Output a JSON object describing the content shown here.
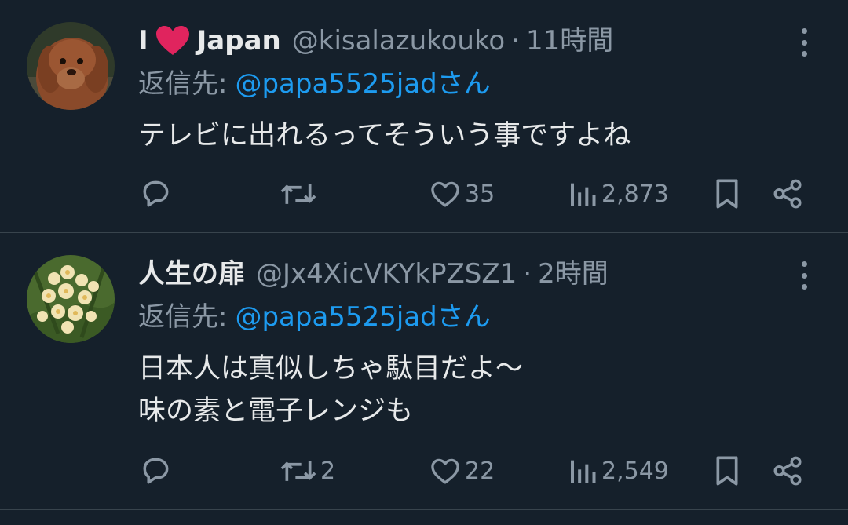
{
  "tweets": [
    {
      "name_prefix": "I",
      "name_suffix": "Japan",
      "handle": "@kisalazukouko",
      "separator": "·",
      "time": "11時間",
      "reply_label": "返信先:",
      "reply_mention": "@papa5525jadさん",
      "text_lines": [
        "テレビに出れるってそういう事ですよね"
      ],
      "reply_count": "",
      "retweet_count": "",
      "like_count": "35",
      "view_count": "2,873"
    },
    {
      "name": "人生の扉",
      "handle": "@Jx4XicVKYkPZSZ1",
      "separator": "·",
      "time": "2時間",
      "reply_label": "返信先:",
      "reply_mention": "@papa5525jadさん",
      "text_lines": [
        "日本人は真似しちゃ駄目だよ〜",
        "味の素と電子レンジも"
      ],
      "reply_count": "",
      "retweet_count": "2",
      "like_count": "22",
      "view_count": "2,549"
    }
  ],
  "colors": {
    "background": "#15202b",
    "divider": "#38444d",
    "text": "#e7e9ea",
    "muted": "#8b98a5",
    "link": "#1d9bf0",
    "heart_emoji": "#e0245e"
  },
  "icons": {
    "reply": "speech-bubble-icon",
    "retweet": "retweet-arrows-icon",
    "like": "heart-outline-icon",
    "views": "bar-chart-icon",
    "bookmark": "bookmark-icon",
    "share": "share-nodes-icon",
    "more": "vertical-dots-icon"
  }
}
